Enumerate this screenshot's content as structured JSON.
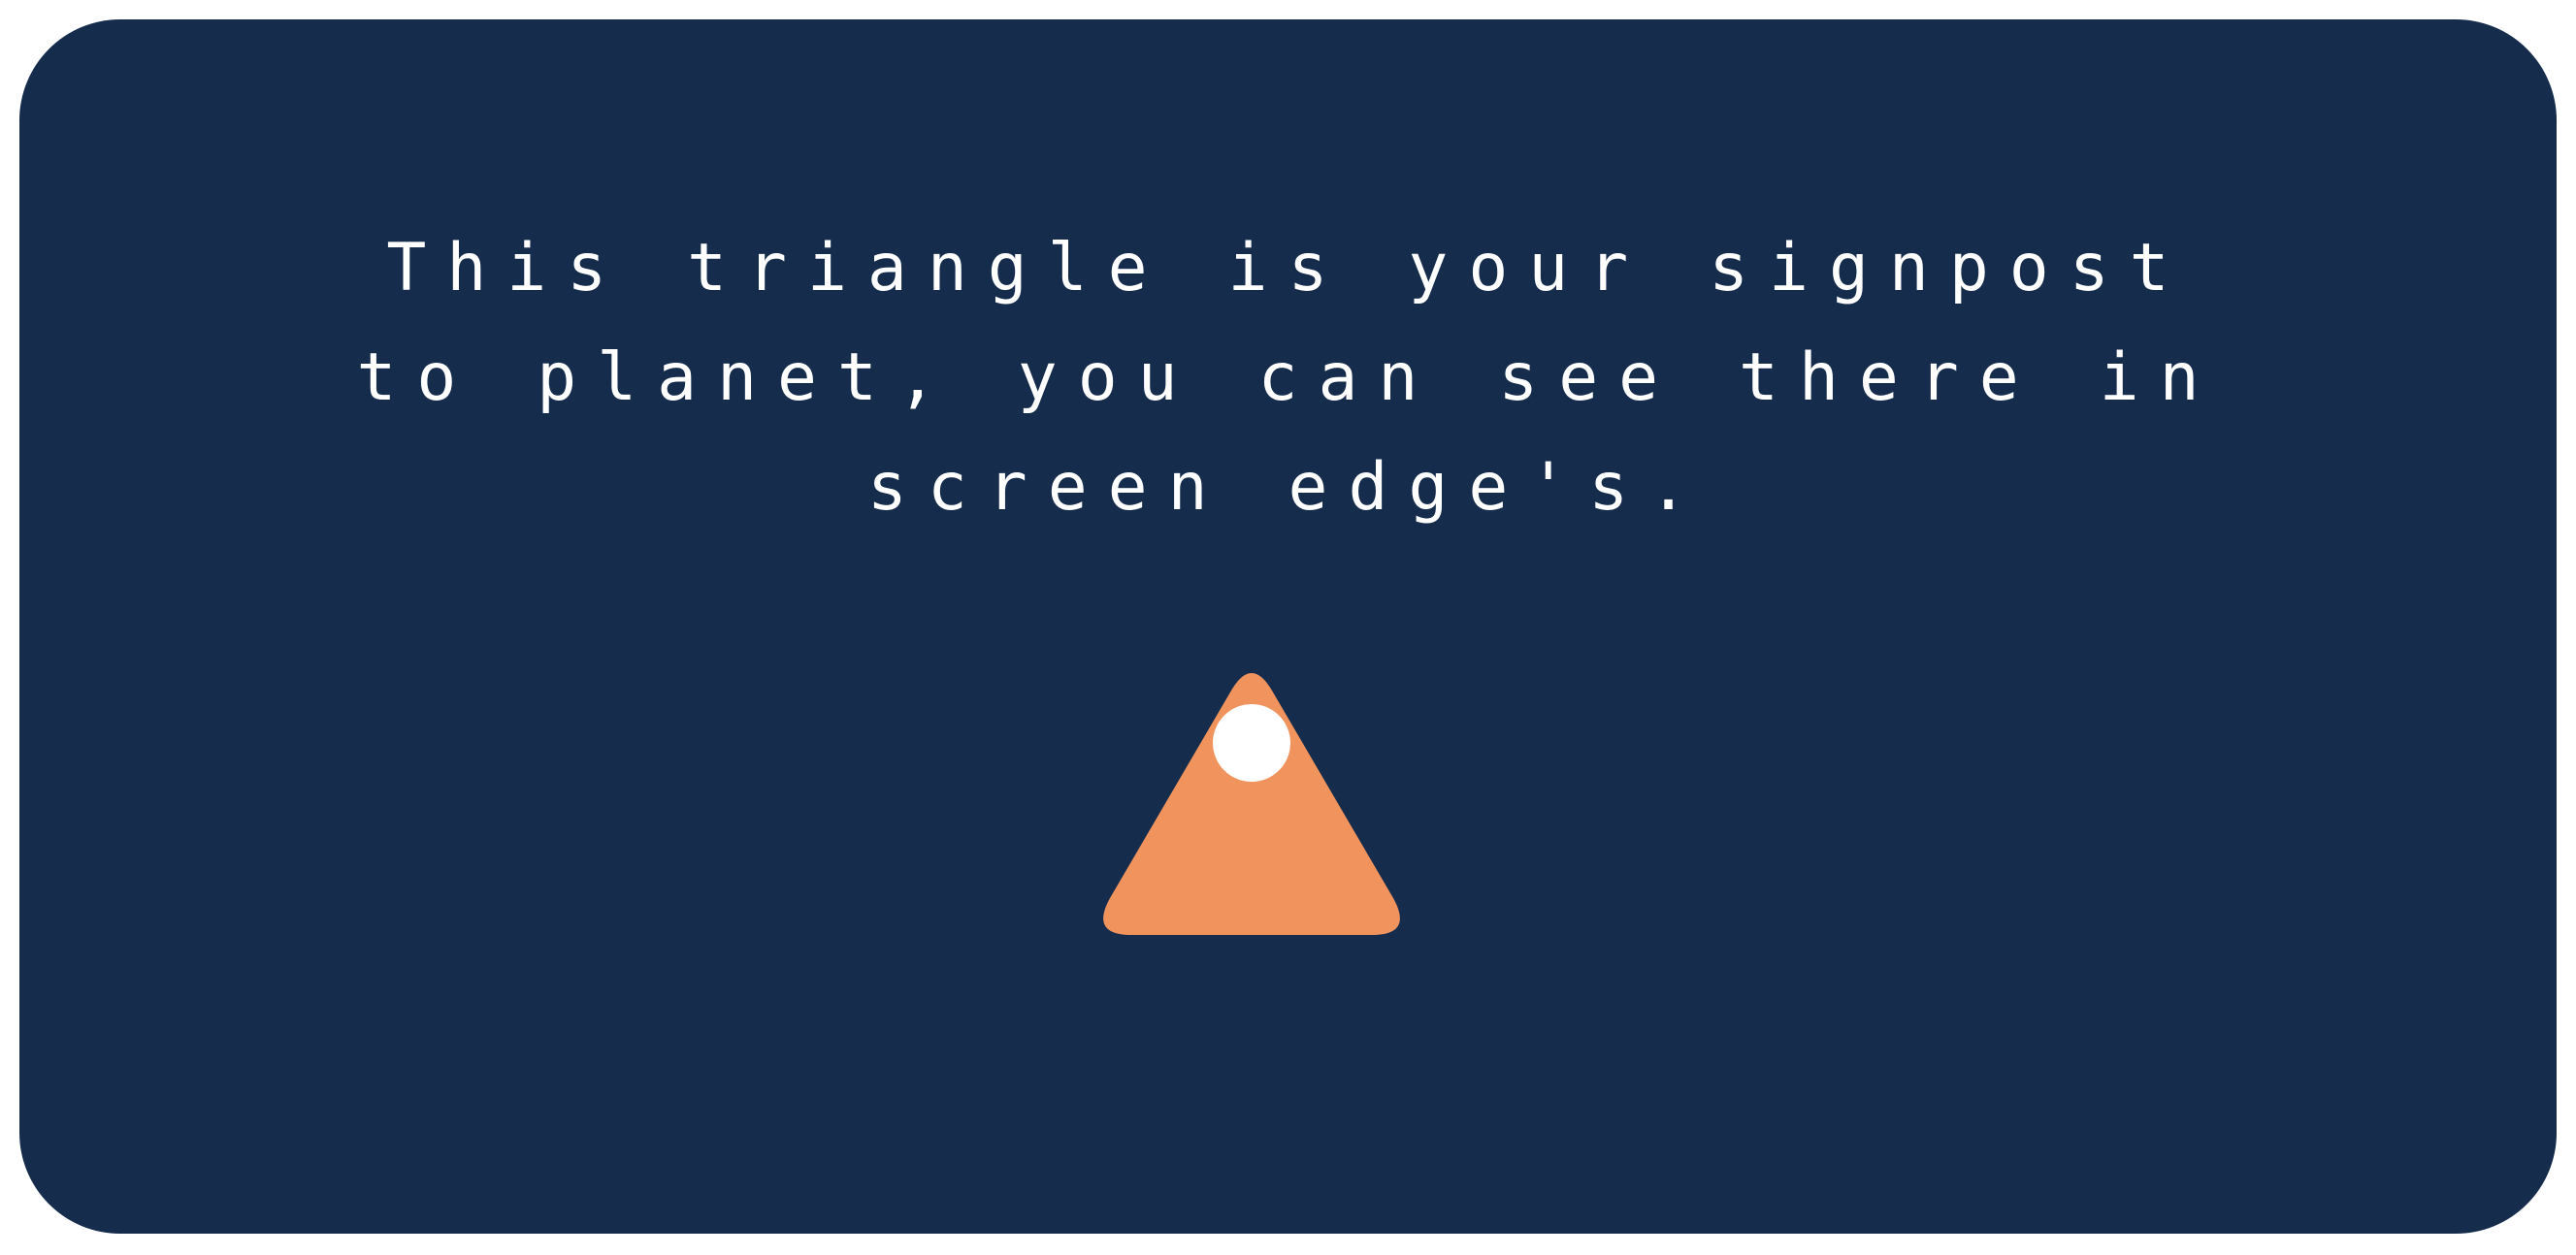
{
  "tutorial": {
    "message": "This triangle is your signpost\nto planet, you can see there in\nscreen edge's."
  },
  "indicator": {
    "icon": "planet-signpost-triangle-icon",
    "triangle_color": "#f0935c",
    "dot_color": "#ffffff"
  },
  "colors": {
    "panel_background": "#152c4c",
    "text": "#ffffff"
  }
}
